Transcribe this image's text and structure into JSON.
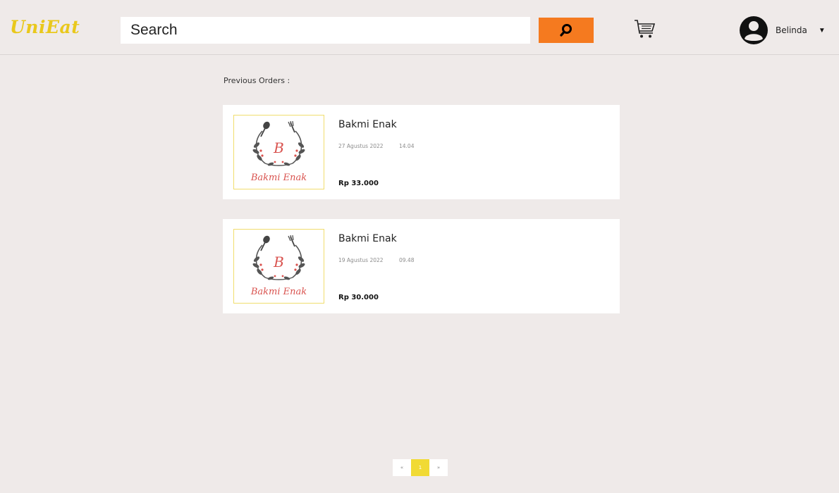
{
  "header": {
    "logo": "UniEat",
    "search": {
      "placeholder": "Search",
      "value": ""
    },
    "search_button_icon": "search-icon",
    "cart_icon": "cart-icon",
    "user": {
      "avatar_icon": "user-avatar-icon",
      "name": "Belinda",
      "menu_icon": "caret-down-icon"
    }
  },
  "main": {
    "title": "Previous Orders :",
    "orders": [
      {
        "restaurant": "Bakmi Enak",
        "logo_text": "Bakmi Enak",
        "logo_letter": "B",
        "date": "27 Agustus 2022",
        "time": "14.04",
        "price": "Rp 33.000"
      },
      {
        "restaurant": "Bakmi Enak",
        "logo_text": "Bakmi Enak",
        "logo_letter": "B",
        "date": "19 Agustus 2022",
        "time": "09.48",
        "price": "Rp 30.000"
      }
    ]
  },
  "pagination": {
    "prev": "«",
    "current": "1",
    "next": "»"
  },
  "colors": {
    "background": "#efeae9",
    "logo": "#e9c81c",
    "search_button": "#f57a1f",
    "active_page": "#f1da34",
    "restaurant_logo_text": "#d9534f"
  }
}
